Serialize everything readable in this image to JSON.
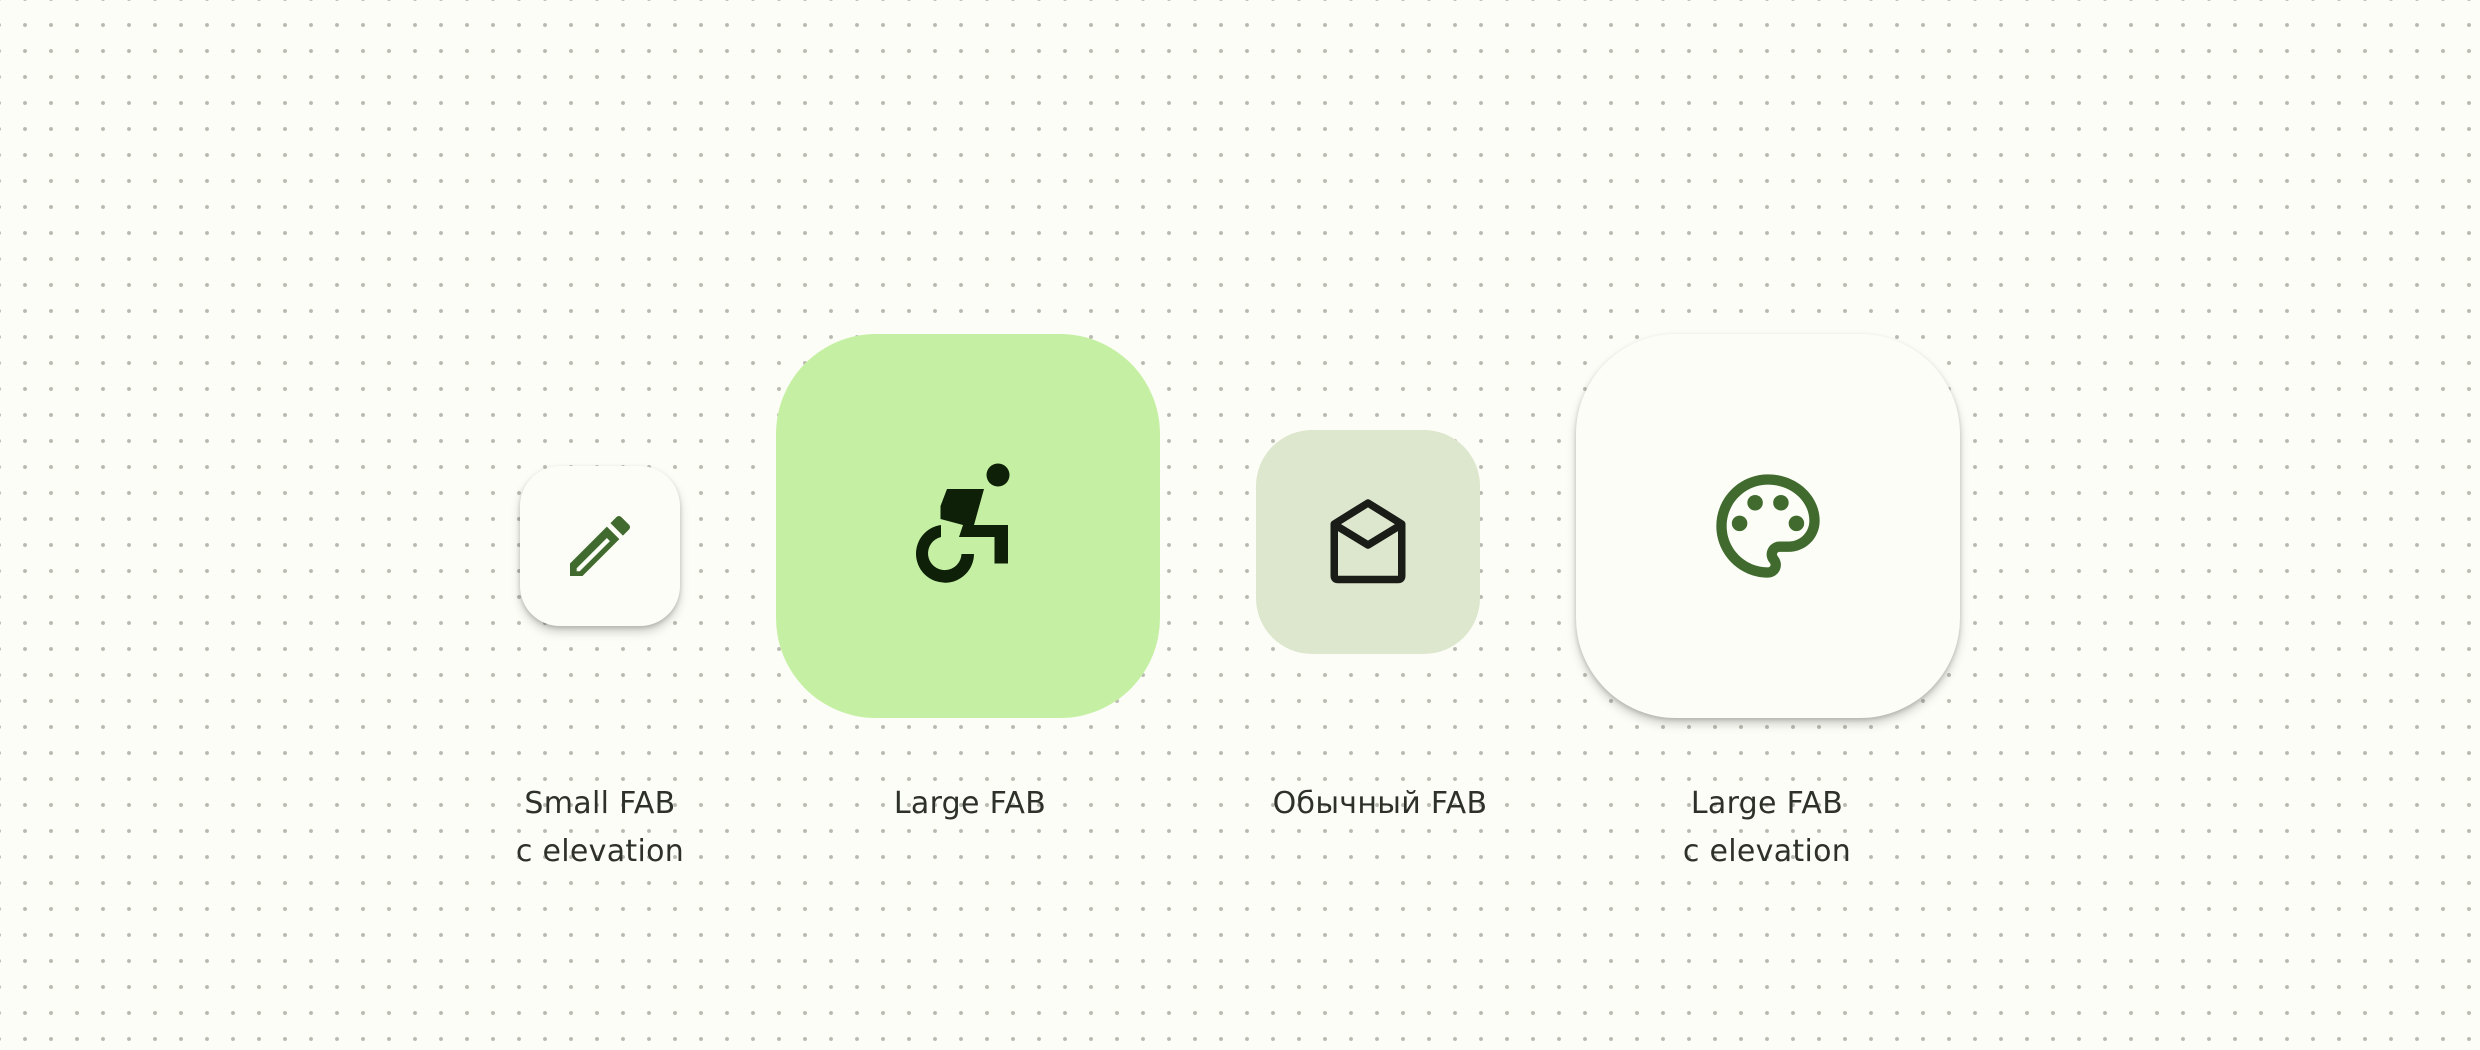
{
  "colors": {
    "background": "#fdfdf7",
    "dot_grid": "#b9bab0",
    "surface": "#fdfdf7",
    "primary_container": "#c5f0a3",
    "secondary_container": "#dce7ce",
    "icon_primary": "#416b2e",
    "icon_dark": "#0e2008",
    "icon_secondary": "#1a1c18",
    "caption_text": "#2e3129"
  },
  "fabs": [
    {
      "icon": "edit-pencil-icon",
      "variant": "small",
      "elevated": true,
      "caption_line1": "Small FAB",
      "caption_line2": "с elevation"
    },
    {
      "icon": "accessible-forward-icon",
      "variant": "large",
      "elevated": false,
      "caption_line1": "Large FAB",
      "caption_line2": ""
    },
    {
      "icon": "drafts-envelope-open-icon",
      "variant": "regular",
      "elevated": false,
      "caption_line1": "Обычный FAB",
      "caption_line2": ""
    },
    {
      "icon": "palette-icon",
      "variant": "large",
      "elevated": true,
      "caption_line1": "Large FAB",
      "caption_line2": "с elevation"
    }
  ]
}
